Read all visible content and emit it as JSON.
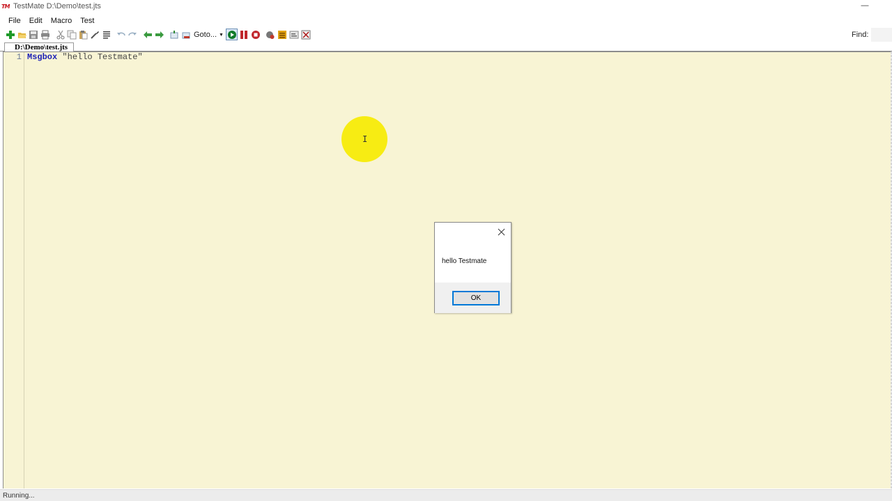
{
  "window": {
    "logo_text": "TM",
    "title": "TestMate D:\\Demo\\test.jts",
    "minimize_glyph": "—"
  },
  "menu": [
    "File",
    "Edit",
    "Macro",
    "Test"
  ],
  "toolbar": {
    "goto_label": "Goto...",
    "goto_arrow": "▼",
    "find_label": "Find:",
    "find_value": ""
  },
  "tab": {
    "label": "D:\\Demo\\test.jts"
  },
  "editor": {
    "lines": [
      {
        "number": "1",
        "keyword": "Msgbox",
        "rest": " \"hello Testmate\""
      }
    ]
  },
  "cursor": {
    "glyph": "I"
  },
  "dialog": {
    "message": "hello Testmate",
    "ok_label": "OK"
  },
  "status": {
    "text": "Running..."
  },
  "colors": {
    "editor_bg": "#f8f4d4",
    "keyword": "#1b1fb6",
    "highlight": "#f7ec13",
    "focus_border": "#0078d7"
  }
}
